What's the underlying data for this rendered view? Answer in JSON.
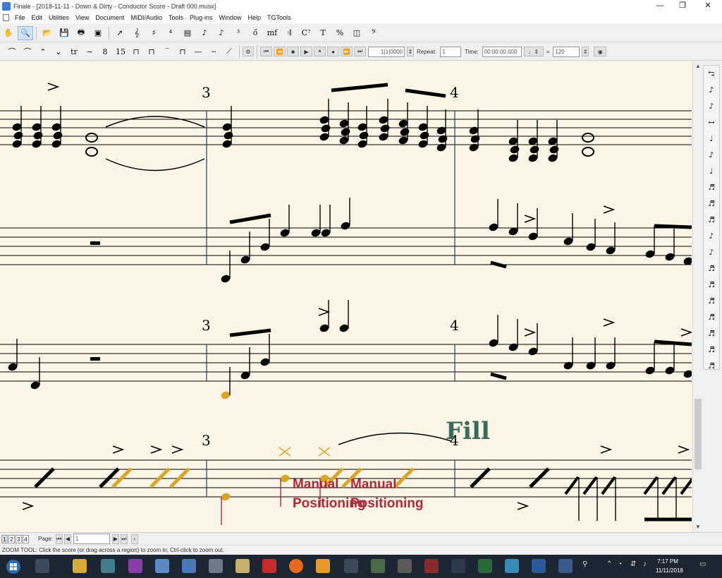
{
  "window": {
    "title": "Finale - [2018-11-11 - Down & Dirty - Conductor Score - Draft 000.musx]",
    "minimize": "—",
    "restore": "❐",
    "close": "✕"
  },
  "menu": [
    "File",
    "Edit",
    "Utilities",
    "View",
    "Document",
    "MIDI/Audio",
    "Tools",
    "Plug-ins",
    "Window",
    "Help",
    "TGTools"
  ],
  "toolbar1": {
    "tools": [
      {
        "name": "hand-tool",
        "glyph": "✋"
      },
      {
        "name": "zoom-tool",
        "glyph": "🔍"
      },
      {
        "name": "open-tool",
        "glyph": "📂"
      },
      {
        "name": "save-tool",
        "glyph": "💾"
      },
      {
        "name": "print-tool",
        "glyph": "🖶"
      },
      {
        "name": "scan-tool",
        "glyph": "▣"
      },
      {
        "name": "selection-tool",
        "glyph": "➚"
      },
      {
        "name": "staff-tool",
        "glyph": "𝄞"
      },
      {
        "name": "key-sig-tool",
        "glyph": "♯"
      },
      {
        "name": "time-sig-tool",
        "glyph": "⁴"
      },
      {
        "name": "measure-tool",
        "glyph": "▤"
      },
      {
        "name": "simple-entry-tool",
        "glyph": "♪"
      },
      {
        "name": "speedy-entry-tool",
        "glyph": "♪"
      },
      {
        "name": "tuplet-tool",
        "glyph": "³"
      },
      {
        "name": "smart-shape-tool",
        "glyph": "ő"
      },
      {
        "name": "expression-tool",
        "glyph": "mf"
      },
      {
        "name": "repeat-tool",
        "glyph": "𝄇"
      },
      {
        "name": "chord-tool",
        "glyph": "C⁷"
      },
      {
        "name": "text-tool",
        "glyph": "T"
      },
      {
        "name": "resize-tool",
        "glyph": "%"
      },
      {
        "name": "page-layout-tool",
        "glyph": "◫"
      },
      {
        "name": "clef-tool",
        "glyph": "𝄢"
      }
    ]
  },
  "toolbar2": {
    "shapes": [
      "⌒",
      "⌒",
      "⌃",
      "⌄",
      "tr",
      "∼",
      "8",
      "15",
      "⊓",
      "⊓",
      "‾",
      "⊓",
      "—",
      "┄",
      "⟋"
    ],
    "playback": {
      "buttons": [
        "⏮",
        "⏪",
        "■",
        "▶",
        "⏸",
        "●",
        "⏩",
        "⏭"
      ],
      "counter": "1|1|0000",
      "repeat_label": "Repeat:",
      "repeat_value": "1",
      "time_label": "Time:",
      "time_value": "00:00:00.000",
      "tempo_equals": "=",
      "tempo_value": "120"
    }
  },
  "score": {
    "measure_numbers": [
      "3",
      "4",
      "3",
      "4",
      "3",
      "4"
    ],
    "text_fill": "Fill",
    "text_manual_1": "Manual",
    "text_manual_2": "Manual",
    "text_positioning_1": "Positioning",
    "text_positioning_2": "Positioning",
    "colors": {
      "paper": "#faf5e4",
      "staff": "#000000",
      "barline_blue": "#1f3f66",
      "hidden": "#d9a628",
      "fill": "#3a6a5c",
      "manual": "#b0283a"
    }
  },
  "pagebar": {
    "pages": [
      "1",
      "2",
      "3",
      "4"
    ],
    "page_label": "Page:",
    "page_value": "1"
  },
  "status": "ZOOM TOOL: Click the score (or drag across a region) to zoom in; Ctrl-click to zoom out.",
  "taskbar": {
    "time": "7:17 PM",
    "date": "11/11/2018"
  }
}
